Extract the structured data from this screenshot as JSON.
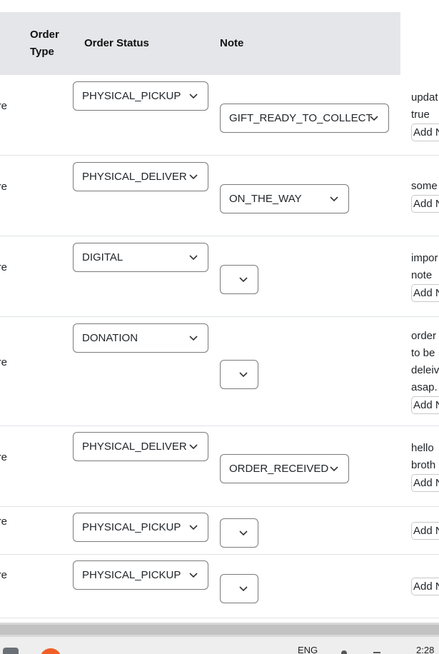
{
  "header": {
    "order_type": "Order Type",
    "order_status": "Order Status",
    "note": "Note"
  },
  "rows": [
    {
      "cut": "re",
      "status": "PHYSICAL_PICKUP",
      "note_value": "GIFT_READY_TO_COLLECT",
      "note_lines": [
        "updat",
        "true"
      ],
      "add": "Add N"
    },
    {
      "cut": "re",
      "status": "PHYSICAL_DELIVER",
      "note_value": "ON_THE_WAY",
      "note_lines": [
        "some"
      ],
      "add": "Add N"
    },
    {
      "cut": "re",
      "status": "DIGITAL",
      "note_value": "",
      "note_lines": [
        "impor",
        "note"
      ],
      "add": "Add N"
    },
    {
      "cut": "re",
      "status": "DONATION",
      "note_value": "",
      "note_lines": [
        "order",
        "to be",
        "deleiv",
        "asap."
      ],
      "add": "Add N"
    },
    {
      "cut": "re",
      "status": "PHYSICAL_DELIVER",
      "note_value": "ORDER_RECEIVED",
      "note_lines": [
        "hello",
        "broth"
      ],
      "add": "Add N"
    },
    {
      "cut": "re",
      "status": "PHYSICAL_PICKUP",
      "note_value": "",
      "note_lines": [],
      "add": "Add N"
    },
    {
      "cut": "re",
      "status": "PHYSICAL_PICKUP",
      "note_value": "",
      "note_lines": [],
      "add": "Add N"
    }
  ],
  "taskbar": {
    "lang": "ENG",
    "time": "2:28"
  },
  "icons": [
    "chevron-down-icon",
    "file-explorer-icon",
    "browser-icon"
  ],
  "colors": {
    "header_bg": "#e5e6e9",
    "border": "#7a7a7a",
    "accent": "#ef5f26"
  }
}
